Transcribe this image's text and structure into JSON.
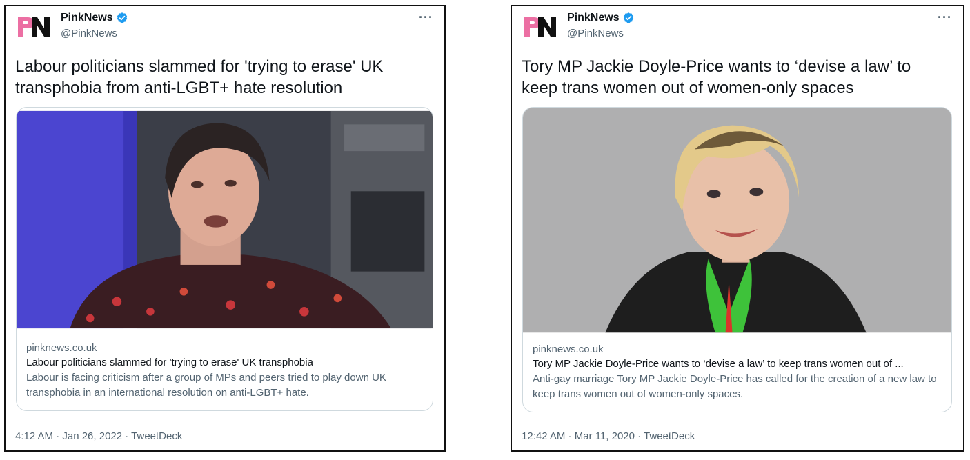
{
  "tweets": [
    {
      "author": {
        "name": "PinkNews",
        "handle": "@PinkNews",
        "logo_text": "PN"
      },
      "text": "Labour politicians slammed for 'trying to erase' UK transphobia from anti-LGBT+ hate resolution",
      "card": {
        "domain": "pinknews.co.uk",
        "title": "Labour politicians slammed for 'trying to erase' UK transphobia",
        "description": "Labour is facing criticism after a group of MPs and peers tried to play down UK transphobia in an international resolution on anti-LGBT+ hate."
      },
      "timestamp": "4:12 AM · Jan 26, 2022 · TweetDeck"
    },
    {
      "author": {
        "name": "PinkNews",
        "handle": "@PinkNews",
        "logo_text": "PN"
      },
      "text": "Tory MP Jackie Doyle-Price wants to ‘devise a law’ to keep trans women out of women-only spaces",
      "card": {
        "domain": "pinknews.co.uk",
        "title": "Tory MP Jackie Doyle-Price wants to ‘devise a law’ to keep trans women out of ...",
        "description": "Anti-gay marriage Tory MP Jackie Doyle-Price has called for the creation of a new law to keep trans women out of women-only spaces."
      },
      "timestamp": "12:42 AM · Mar 11, 2020 · TweetDeck"
    }
  ],
  "colors": {
    "verified": "#1d9bf0",
    "logo_pink": "#ec6fa3",
    "logo_dark": "#111111",
    "muted": "#536471"
  },
  "icons": [
    "verified-badge-icon",
    "more-options-icon"
  ]
}
